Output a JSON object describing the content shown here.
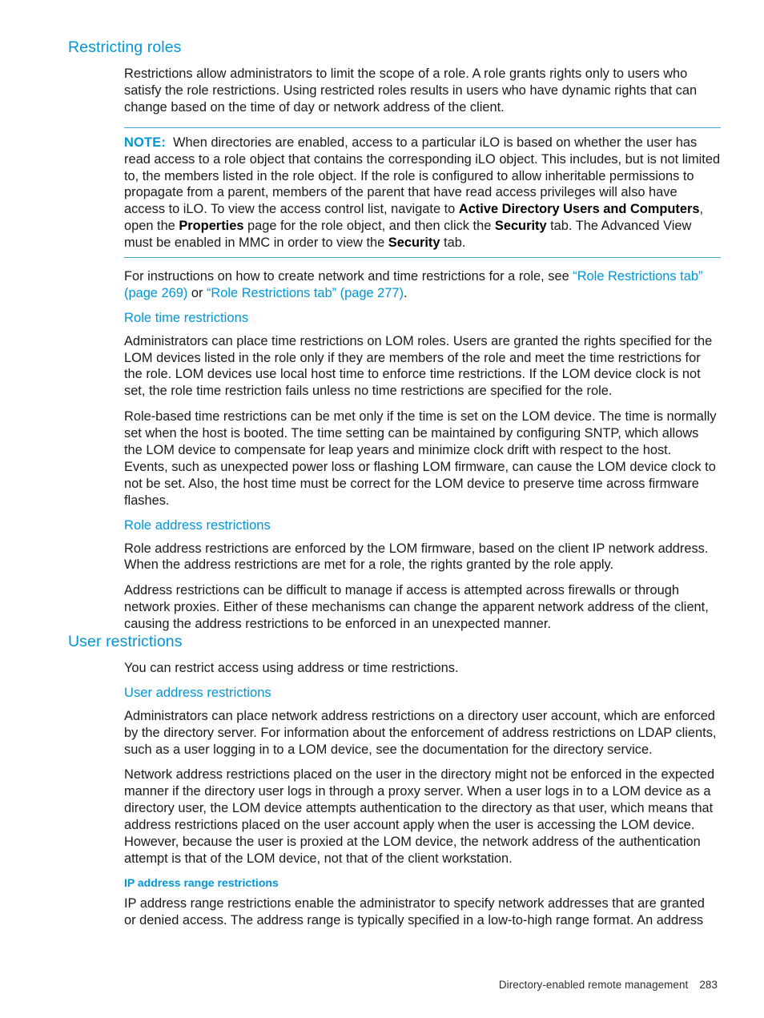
{
  "page": {
    "number": "283",
    "footer_title": "Directory-enabled remote management"
  },
  "colors": {
    "heading_blue": "#0096D6",
    "link_blue": "#0096D6",
    "note_rule": "#3BA7DD",
    "body_text": "#1A1A1A"
  },
  "sections": {
    "restricting_roles": {
      "heading": "Restricting roles",
      "intro": "Restrictions allow administrators to limit the scope of a role. A role grants rights only to users who satisfy the role restrictions. Using restricted roles results in users who have dynamic rights that can change based on the time of day or network address of the client.",
      "note": {
        "label": "NOTE:",
        "text_1": "When directories are enabled, access to a particular iLO is based on whether the user has read access to a role object that contains the corresponding iLO object. This includes, but is not limited to, the members listed in the role object. If the role is configured to allow inheritable permissions to propagate from a parent, members of the parent that have read access privileges will also have access to iLO. To view the access control list, navigate to ",
        "bold_1": "Active Directory Users and Computers",
        "text_2": ", open the ",
        "bold_2": "Properties",
        "text_3": " page for the role object, and then click the ",
        "bold_3": "Security",
        "text_4": " tab. The Advanced View must be enabled in MMC in order to view the ",
        "bold_4": "Security",
        "text_5": " tab."
      },
      "instructions": {
        "lead": "For instructions on how to create network and time restrictions for a role, see ",
        "link_1": "“Role Restrictions tab” (page 269)",
        "between": " or ",
        "link_2": "“Role Restrictions tab” (page 277)",
        "tail": "."
      }
    },
    "role_time_restrictions": {
      "heading": "Role time restrictions",
      "paragraph_1": "Administrators can place time restrictions on LOM roles. Users are granted the rights specified for the LOM devices listed in the role only if they are members of the role and meet the time restrictions for the role. LOM devices use local host time to enforce time restrictions. If the LOM device clock is not set, the role time restriction fails unless no time restrictions are specified for the role.",
      "paragraph_2": "Role-based time restrictions can be met only if the time is set on the LOM device. The time is normally set when the host is booted. The time setting can be maintained by configuring SNTP, which allows the LOM device to compensate for leap years and minimize clock drift with respect to the host. Events, such as unexpected power loss or flashing LOM firmware, can cause the LOM device clock to not be set. Also, the host time must be correct for the LOM device to preserve time across firmware flashes."
    },
    "role_address_restrictions": {
      "heading": "Role address restrictions",
      "paragraph_1": "Role address restrictions are enforced by the LOM firmware, based on the client IP network address. When the address restrictions are met for a role, the rights granted by the role apply.",
      "paragraph_2": "Address restrictions can be difficult to manage if access is attempted across firewalls or through network proxies. Either of these mechanisms can change the apparent network address of the client, causing the address restrictions to be enforced in an unexpected manner."
    },
    "user_restrictions": {
      "heading": "User restrictions",
      "intro": "You can restrict access using address or time restrictions."
    },
    "user_address_restrictions": {
      "heading": "User address restrictions",
      "paragraph_1": "Administrators can place network address restrictions on a directory user account, which are enforced by the directory server. For information about the enforcement of address restrictions on LDAP clients, such as a user logging in to a LOM device, see the documentation for the directory service.",
      "paragraph_2": "Network address restrictions placed on the user in the directory might not be enforced in the expected manner if the directory user logs in through a proxy server. When a user logs in to a LOM device as a directory user, the LOM device attempts authentication to the directory as that user, which means that address restrictions placed on the user account apply when the user is accessing the LOM device. However, because the user is proxied at the LOM device, the network address of the authentication attempt is that of the LOM device, not that of the client workstation."
    },
    "ip_address_range_restrictions": {
      "heading": "IP address range restrictions",
      "paragraph_1": "IP address range restrictions enable the administrator to specify network addresses that are granted or denied access. The address range is typically specified in a low-to-high range format. An address"
    }
  }
}
